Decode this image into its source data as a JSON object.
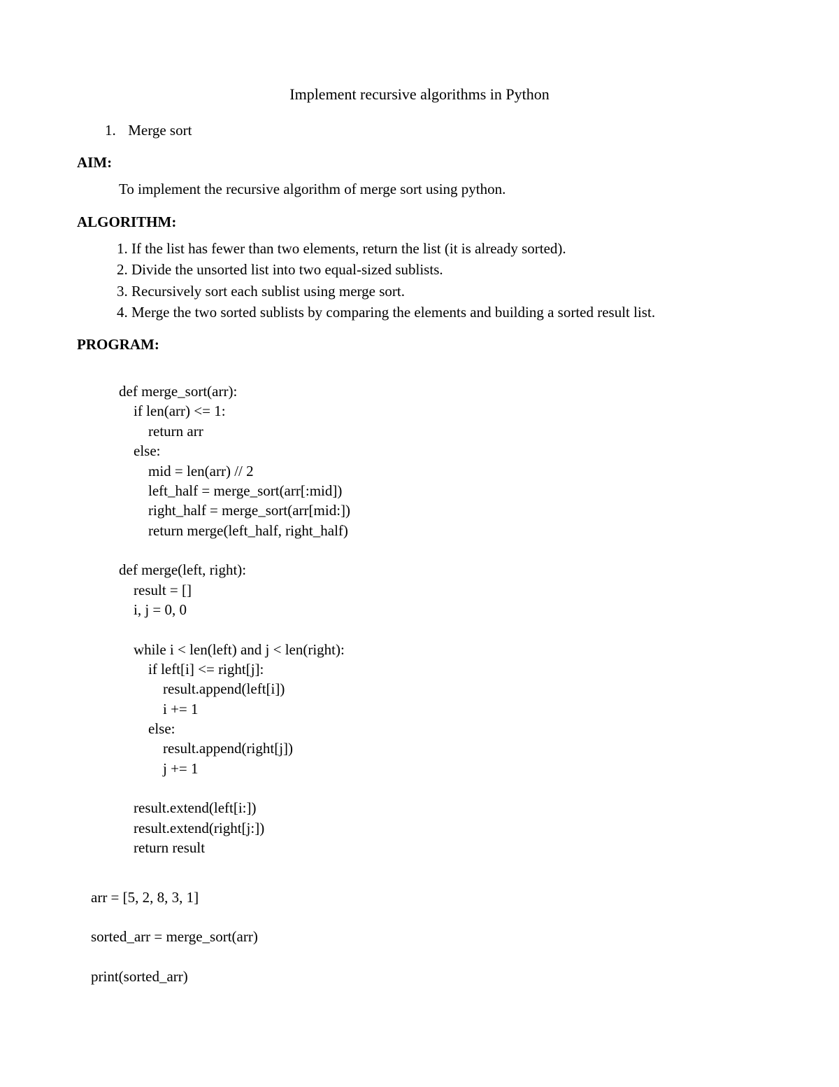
{
  "title": "Implement recursive algorithms in Python",
  "topic": {
    "num": "1.",
    "name": "Merge sort"
  },
  "sections": {
    "aim_head": "AIM:",
    "aim_text": "To implement the recursive algorithm of merge sort using python.",
    "algo_head": "ALGORITHM:",
    "algo_items": [
      "If the list has fewer than two elements, return the list (it is already sorted).",
      "Divide the unsorted list into two equal-sized sublists.",
      "Recursively sort each sublist using merge sort.",
      "Merge the two sorted sublists by comparing the elements and building a sorted result list."
    ],
    "prog_head": "PROGRAM:"
  },
  "code": {
    "l01": "def merge_sort(arr):",
    "l02": "    if len(arr) <= 1:",
    "l03": "        return arr",
    "l04": "    else:",
    "l05": "        mid = len(arr) // 2",
    "l06": "        left_half = merge_sort(arr[:mid])",
    "l07": "        right_half = merge_sort(arr[mid:])",
    "l08": "        return merge(left_half, right_half)",
    "l10": "def merge(left, right):",
    "l11": "    result = []",
    "l12": "    i, j = 0, 0",
    "l14": "    while i < len(left) and j < len(right):",
    "l15": "        if left[i] <= right[j]:",
    "l16": "            result.append(left[i])",
    "l17": "            i += 1",
    "l18": "        else:",
    "l19": "            result.append(right[j])",
    "l20": "            j += 1",
    "l22": "    result.extend(left[i:])",
    "l23": "    result.extend(right[j:])",
    "l24": "    return result",
    "t1": "arr = [5, 2, 8, 3, 1]",
    "t2": "sorted_arr = merge_sort(arr)",
    "t3": "print(sorted_arr)"
  }
}
